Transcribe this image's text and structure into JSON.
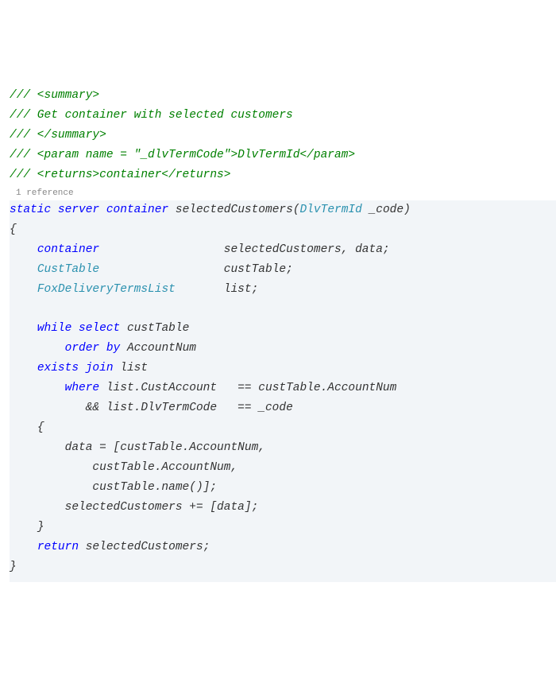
{
  "doc": {
    "line1": "/// <summary>",
    "line2": "/// Get container with selected customers",
    "line3": "/// </summary>",
    "line4": "/// <param name = \"_dlvTermCode\">DlvTermId</param>",
    "line5": "/// <returns>container</returns>"
  },
  "reference": "1 reference",
  "code": {
    "kw_static": "static",
    "kw_server": "server",
    "kw_container": "container",
    "method_name": "selectedCustomers",
    "param_type": "DlvTermId",
    "param_name": "_code",
    "open_brace": "{",
    "decl_container_kw": "container",
    "decl_container_vars": "selectedCustomers, data;",
    "decl_custtable_type": "CustTable",
    "decl_custtable_var": "custTable;",
    "decl_list_type": "FoxDeliveryTermsList",
    "decl_list_var": "list;",
    "kw_while": "while",
    "kw_select": "select",
    "select_var": "custTable",
    "kw_order": "order",
    "kw_by": "by",
    "orderby_field": "AccountNum",
    "kw_exists": "exists",
    "kw_join": "join",
    "join_var": "list",
    "kw_where": "where",
    "where_left1": "list.CustAccount",
    "where_op1": "==",
    "where_right1": "custTable.AccountNum",
    "where_and": "&&",
    "where_left2": "list.DlvTermCode",
    "where_op2": "==",
    "where_right2": "_code",
    "inner_open": "{",
    "data_assign": "data = [custTable.AccountNum,",
    "data_line2": "custTable.AccountNum,",
    "data_line3": "custTable.name()];",
    "sel_append": "selectedCustomers += [data];",
    "inner_close": "}",
    "kw_return": "return",
    "return_var": "selectedCustomers;",
    "close_brace": "}"
  }
}
